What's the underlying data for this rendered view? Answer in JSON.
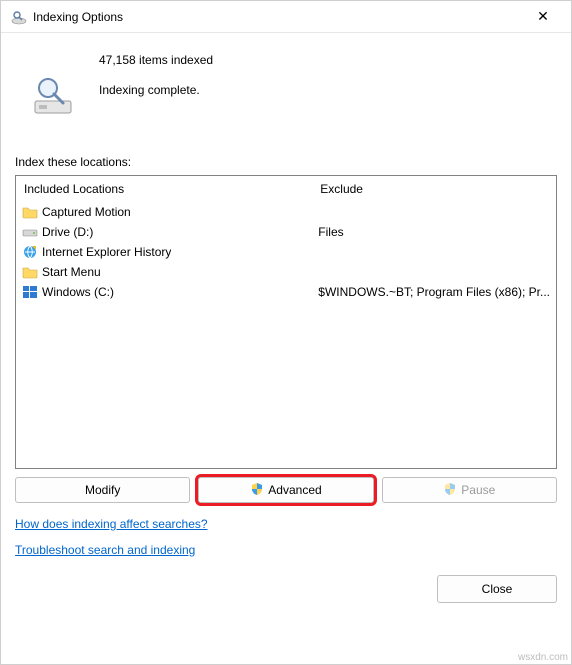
{
  "window": {
    "title": "Indexing Options",
    "close_glyph": "✕"
  },
  "status": {
    "count_line": "47,158 items indexed",
    "state_line": "Indexing complete."
  },
  "section_label": "Index these locations:",
  "columns": {
    "included": "Included Locations",
    "exclude": "Exclude"
  },
  "locations": [
    {
      "icon": "folder",
      "name": "Captured Motion",
      "exclude": ""
    },
    {
      "icon": "drive",
      "name": "Drive (D:)",
      "exclude": "Files"
    },
    {
      "icon": "ie",
      "name": "Internet Explorer History",
      "exclude": ""
    },
    {
      "icon": "folder",
      "name": "Start Menu",
      "exclude": ""
    },
    {
      "icon": "windows",
      "name": "Windows (C:)",
      "exclude": "$WINDOWS.~BT; Program Files (x86); Pr..."
    }
  ],
  "buttons": {
    "modify": "Modify",
    "advanced": "Advanced",
    "pause": "Pause"
  },
  "links": {
    "help": "How does indexing affect searches?",
    "troubleshoot": "Troubleshoot search and indexing"
  },
  "footer": {
    "close": "Close"
  },
  "watermark": "wsxdn.com"
}
